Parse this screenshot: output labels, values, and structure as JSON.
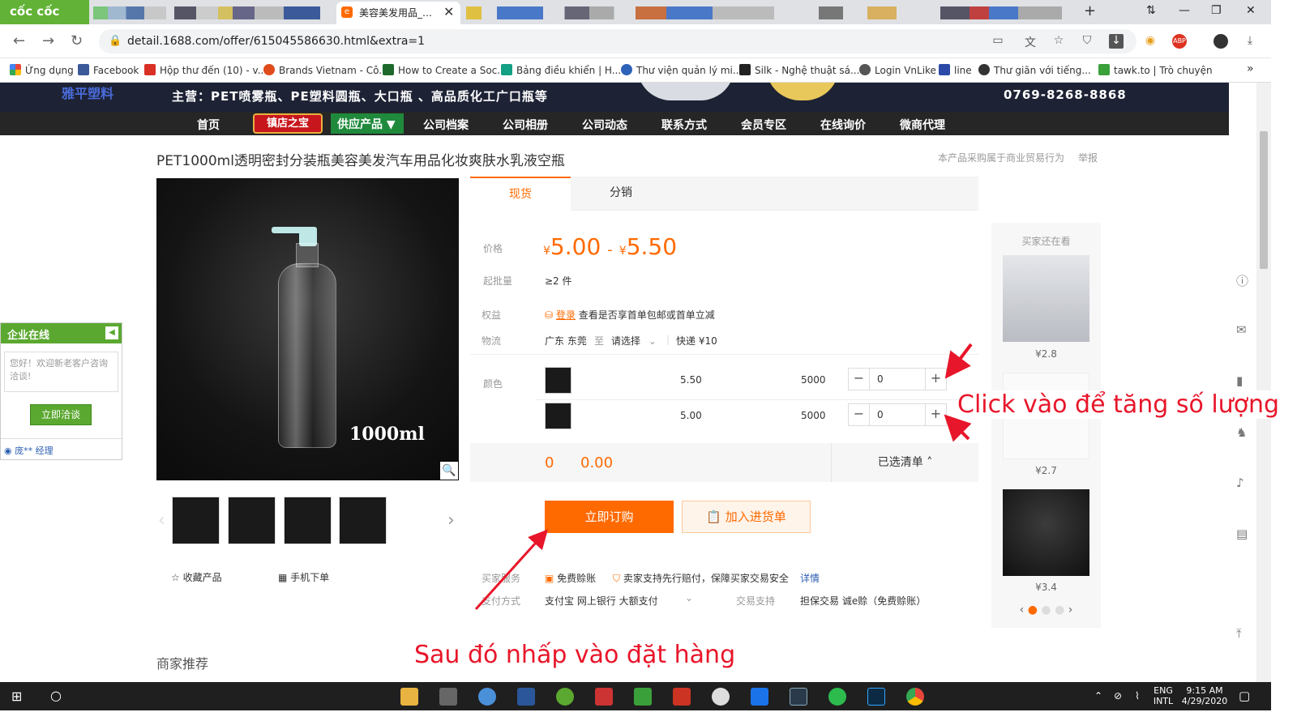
{
  "browser": {
    "brand": "cốc cốc",
    "active_tab_title": "美容美发用品_…",
    "url": "detail.1688.com/offer/615045586630.html&extra=1",
    "bookmarks": [
      {
        "label": "Ứng dụng",
        "color": "#e8453c"
      },
      {
        "label": "Facebook",
        "color": "#3b5998"
      },
      {
        "label": "Hộp thư đến (10) - v...",
        "color": "#d93025"
      },
      {
        "label": "Brands Vietnam - Cô...",
        "color": "#e04b1b"
      },
      {
        "label": "How to Create a Soc...",
        "color": "#1d6a2c"
      },
      {
        "label": "Bảng điều khiển | H...",
        "color": "#14a085"
      },
      {
        "label": "Thư viện quản lý mi...",
        "color": "#2d62b8"
      },
      {
        "label": "Silk - Nghệ thuật sá...",
        "color": "#222222"
      },
      {
        "label": "Login VnLike",
        "color": "#555555"
      },
      {
        "label": "line",
        "color": "#2b4aa8"
      },
      {
        "label": "Thư giãn với tiếng...",
        "color": "#333333"
      },
      {
        "label": "tawk.to | Trò chuyện",
        "color": "#3aa03a"
      }
    ]
  },
  "shop": {
    "brand": "雅平塑料",
    "slogan": "主营：PET喷雾瓶、PE塑料圆瓶、大口瓶 、高品质化工广口瓶等",
    "phone": "0769-8268-8868",
    "nav": {
      "home": "首页",
      "hot": "镇店之宝",
      "supply": "供应产品 ▼",
      "items": [
        "公司档案",
        "公司相册",
        "公司动态",
        "联系方式",
        "会员专区",
        "在线询价",
        "微商代理"
      ]
    }
  },
  "product": {
    "title": "PET1000ml透明密封分装瓶美容美发汽车用品化妆爽肤水乳液空瓶",
    "top_note": "本产品采购属于商业贸易行为",
    "report": "举报",
    "image_caption": "1000ml",
    "tabs": [
      "现货",
      "分销"
    ],
    "price_label": "价格",
    "currency": "¥",
    "price_low": "5.00",
    "price_high": "5.50",
    "moq_label": "起批量",
    "moq": "≥2 件",
    "benefit_label": "权益",
    "benefit_login": "登录",
    "benefit_text": "查看是否享首单包邮或首单立减",
    "logistics_label": "物流",
    "origin": "广东 东莞",
    "to": "至",
    "dest": "请选择",
    "shipping": "快递 ¥10",
    "color_label": "颜色",
    "skus": [
      {
        "price": "5.50",
        "stock": "5000",
        "qty": "0"
      },
      {
        "price": "5.00",
        "stock": "5000",
        "qty": "0"
      }
    ],
    "total_qty": "0",
    "total_amount": "0.00",
    "selected_list": "已选清单 ˄",
    "order_button": "立即订购",
    "cart_button": "加入进货单",
    "collect": "收藏产品",
    "mobile_order": "手机下单",
    "service_label": "买家服务",
    "service_items": [
      "免费赊账",
      "卖家支持先行赔付，保障买家交易安全"
    ],
    "details_link": "详情",
    "payment_label": "支付方式",
    "payment_methods": "支付宝  网上银行  大额支付",
    "trade_label": "交易支持",
    "trade_methods": "担保交易  诚e赊（免费赊账）",
    "recommend": "商家推荐"
  },
  "sidebar": {
    "heading": "买家还在看",
    "items": [
      {
        "price": "¥2.8"
      },
      {
        "price": "¥2.7"
      },
      {
        "price": "¥3.4"
      }
    ]
  },
  "chat": {
    "title": "企业在线",
    "greeting": "您好！欢迎新老客户咨询洽谈!",
    "button": "立即洽谈",
    "manager": "庞** 经理"
  },
  "annotations": {
    "increase_qty": "Click vào để tăng số lượng",
    "place_order": "Sau đó nhấp vào đặt hàng"
  },
  "taskbar": {
    "lang": "ENG",
    "layout": "INTL",
    "time": "9:15 AM",
    "date": "4/29/2020"
  }
}
